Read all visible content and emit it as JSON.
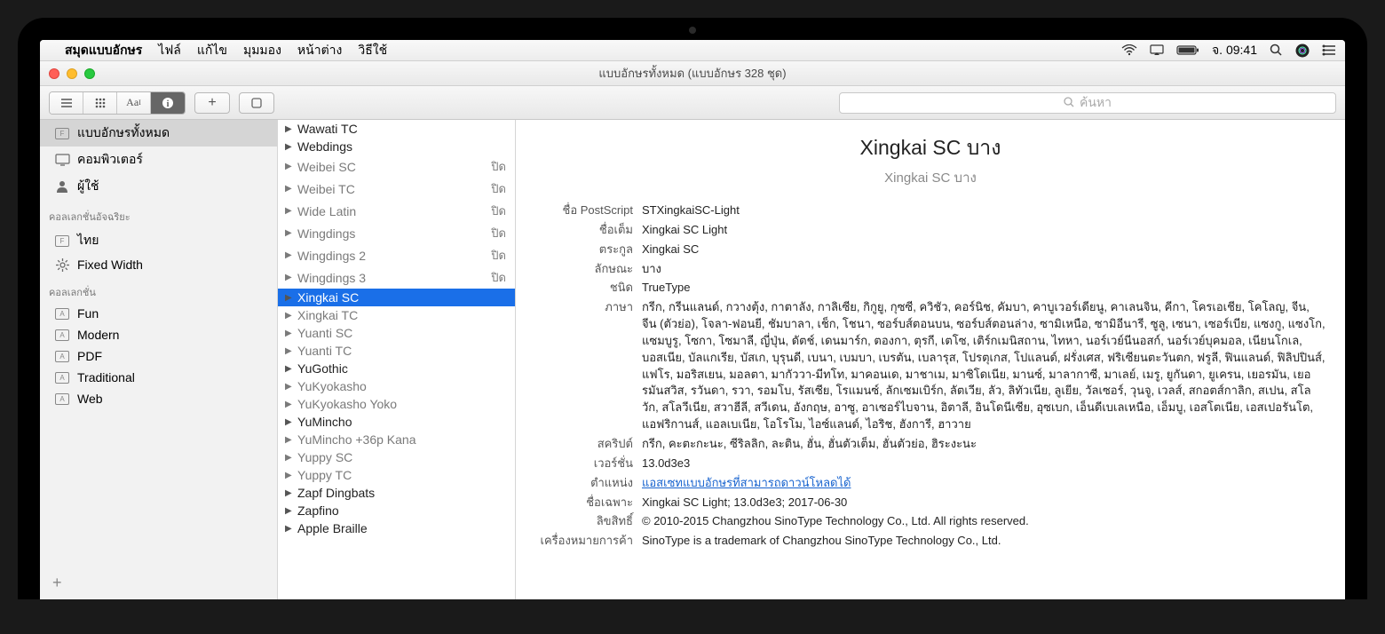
{
  "menubar": {
    "app_name": "สมุดแบบอักษร",
    "items": [
      "ไฟล์",
      "แก้ไข",
      "มุมมอง",
      "หน้าต่าง",
      "วิธีใช้"
    ],
    "clock": "จ. 09:41"
  },
  "window_title": "แบบอักษรทั้งหมด (แบบอักษร 328 ชุด)",
  "search": {
    "placeholder": "ค้นหา"
  },
  "sidebar": {
    "main": [
      {
        "icon": "F",
        "label": "แบบอักษรทั้งหมด",
        "selected": true
      },
      {
        "icon": "monitor",
        "label": "คอมพิวเตอร์"
      },
      {
        "icon": "person",
        "label": "ผู้ใช้"
      }
    ],
    "header1": "คอลเลกชั่นอัจฉริยะ",
    "smart": [
      {
        "icon": "F",
        "label": "ไทย"
      },
      {
        "icon": "gear",
        "label": "Fixed Width"
      }
    ],
    "header2": "คอลเลกชั่น",
    "collections": [
      {
        "label": "Fun"
      },
      {
        "label": "Modern"
      },
      {
        "label": "PDF"
      },
      {
        "label": "Traditional"
      },
      {
        "label": "Web"
      }
    ]
  },
  "font_list": [
    {
      "name": "Wawati TC",
      "black": true
    },
    {
      "name": "Webdings",
      "black": true
    },
    {
      "name": "Weibei SC",
      "status": "ปิด"
    },
    {
      "name": "Weibei TC",
      "status": "ปิด"
    },
    {
      "name": "Wide Latin",
      "status": "ปิด"
    },
    {
      "name": "Wingdings",
      "status": "ปิด"
    },
    {
      "name": "Wingdings 2",
      "status": "ปิด"
    },
    {
      "name": "Wingdings 3",
      "status": "ปิด"
    },
    {
      "name": "Xingkai SC",
      "selected": true,
      "black": true
    },
    {
      "name": "Xingkai TC"
    },
    {
      "name": "Yuanti SC"
    },
    {
      "name": "Yuanti TC"
    },
    {
      "name": "YuGothic",
      "black": true
    },
    {
      "name": "YuKyokasho"
    },
    {
      "name": "YuKyokasho Yoko"
    },
    {
      "name": "YuMincho",
      "black": true
    },
    {
      "name": "YuMincho +36p Kana"
    },
    {
      "name": "Yuppy SC"
    },
    {
      "name": "Yuppy TC"
    },
    {
      "name": "Zapf Dingbats",
      "black": true
    },
    {
      "name": "Zapfino",
      "black": true
    },
    {
      "name": "Apple Braille",
      "black": true
    }
  ],
  "detail": {
    "title": "Xingkai SC บาง",
    "subtitle": "Xingkai SC บาง",
    "rows": [
      {
        "label": "ชื่อ PostScript",
        "value": "STXingkaiSC-Light"
      },
      {
        "label": "ชื่อเต็ม",
        "value": "Xingkai SC Light"
      },
      {
        "label": "ตระกูล",
        "value": "Xingkai SC"
      },
      {
        "label": "ลักษณะ",
        "value": "บาง"
      },
      {
        "label": "ชนิด",
        "value": "TrueType"
      },
      {
        "label": "ภาษา",
        "value": "กรีก, กรีนแลนด์, กวางตุ้ง, กาตาลัง, กาลิเซีย, กิกูยู, กุซซี, ควิชัว, คอร์นิช, คัมบา, คาบูเวอร์เดียนู, คาเลนจิน, คีกา, โครเอเชีย, โคโลญ, จีน, จีน (ตัวย่อ), โจลา-ฟอนยี, ชัมบาลา, เช็ก, โชนา, ซอร์บส์ตอนบน, ซอร์บส์ตอนล่าง, ซามิเหนือ, ซามิอีนารี, ซูลู, เซนา, เซอร์เบีย, แซงกู, แซงโก, แซมบูรู, โซกา, โซมาลี, ญี่ปุ่น, ดัตช์, เดนมาร์ก, ตองกา, ตุรกี, เตโซ, เติร์กเมนิสถาน, ไทหา, นอร์เวย์นีนอสก์, นอร์เวย์บุคมอล, เนียนโกเล, บอสเนีย, บัลแกเรีย, บัสเก, บุรุนดี, เบนา, เบมบา, เบรตัน, เบลารุส, โปรตุเกส, โปแลนด์, ฝรั่งเศส, ฟริเซียนตะวันตก, ฟรูลี, ฟินแลนด์, ฟิลิปปินส์, แฟโร, มอริสเยน, มอลตา, มากัววา-มีทโท, มาคอนเด, มาชาเม, มาซิโดเนีย, มานซ์, มาลากาซี, มาเลย์, เมรู, ยูกันดา, ยูเครน, เยอรมัน, เยอรมันสวิส, รวันดา, รวา, รอมโบ, รัสเซีย, โรแมนซ์, ลักเซมเบิร์ก, ลัตเวีย, ลัว, ลิทัวเนีย, ลูเยีย, วัลเซอร์, วุนจู, เวลส์, สกอตส์กาลิก, สเปน, สโลวัก, สโลวีเนีย, สวาฮีลี, สวีเดน, อังกฤษ, อาซู, อาเซอร์ไบจาน, อิตาลี, อินโดนีเซีย, อุซเบก, เอ็นดีเบเลเหนือ, เอ็มบู, เอสโตเนีย, เอสเปอรันโต, แอฟริกานส์, แอลเบเนีย, โอโรโม, ไอซ์แลนด์, ไอริช, ฮังการี, ฮาวาย"
      },
      {
        "label": "สคริปต์",
        "value": "กรีก, คะตะกะนะ, ซีริลลิก, ละติน, ฮั่น, ฮั่นตัวเต็ม, ฮั่นตัวย่อ, ฮิระงะนะ"
      },
      {
        "label": "เวอร์ชั่น",
        "value": "13.0d3e3"
      },
      {
        "label": "ตำแหน่ง",
        "value": "แอสเซทแบบอักษรที่สามารถดาวน์โหลดได้",
        "link": true
      },
      {
        "label": "ชื่อเฉพาะ",
        "value": "Xingkai SC Light; 13.0d3e3; 2017-06-30"
      },
      {
        "label": "ลิขสิทธิ์",
        "value": "© 2010-2015 Changzhou SinoType Technology Co., Ltd.  All rights reserved."
      },
      {
        "label": "เครื่องหมายการค้า",
        "value": "SinoType is a trademark of Changzhou SinoType Technology Co., Ltd."
      }
    ]
  }
}
